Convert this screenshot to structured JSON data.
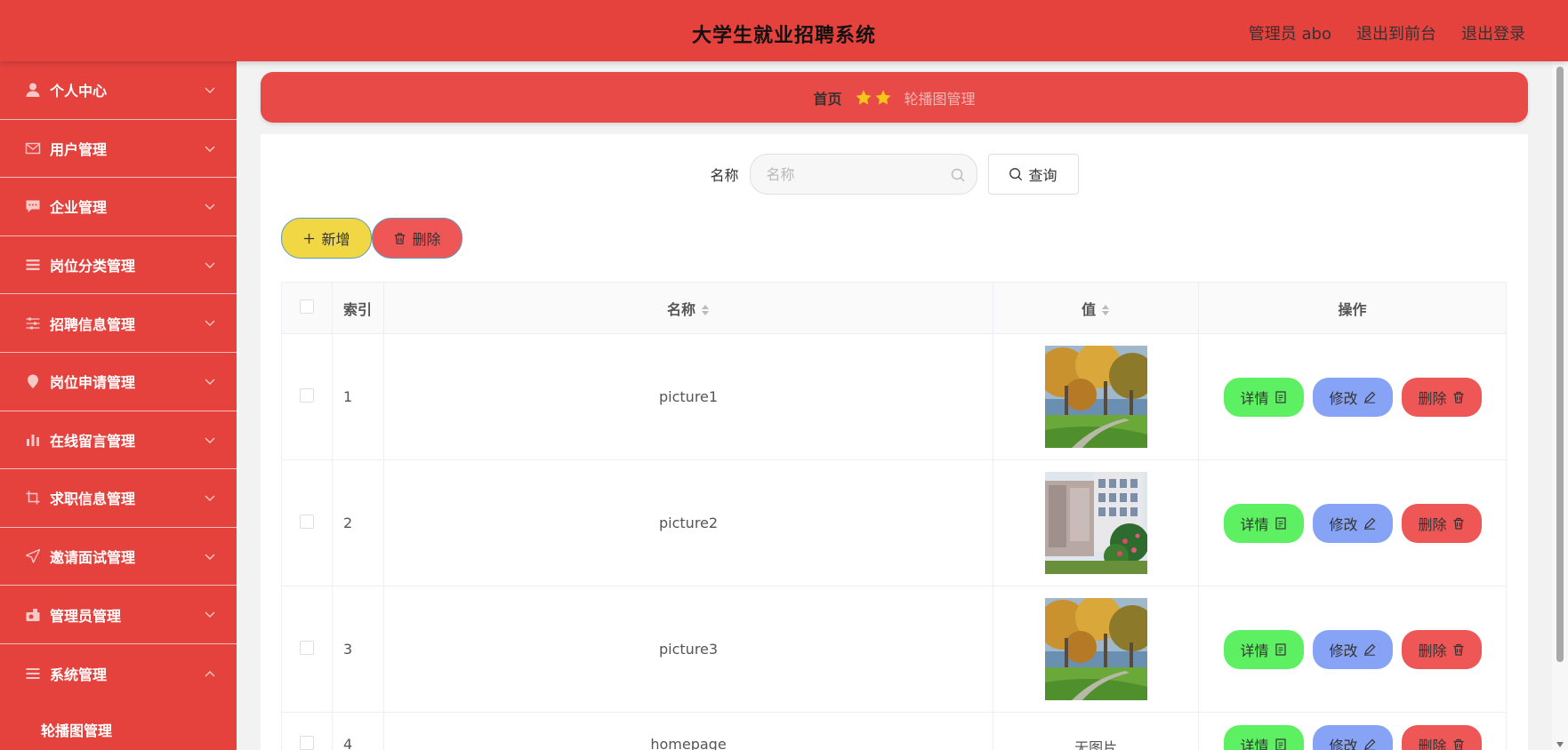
{
  "header": {
    "title": "大学生就业招聘系统",
    "links": [
      "管理员 abo",
      "退出到前台",
      "退出登录"
    ]
  },
  "sidebar": {
    "items": [
      {
        "label": "个人中心",
        "icon": "user-icon",
        "expanded": false
      },
      {
        "label": "用户管理",
        "icon": "mail-icon",
        "expanded": false
      },
      {
        "label": "企业管理",
        "icon": "chat-icon",
        "expanded": false
      },
      {
        "label": "岗位分类管理",
        "icon": "list-icon",
        "expanded": false
      },
      {
        "label": "招聘信息管理",
        "icon": "sliders-icon",
        "expanded": false
      },
      {
        "label": "岗位申请管理",
        "icon": "pin-icon",
        "expanded": false
      },
      {
        "label": "在线留言管理",
        "icon": "bar-chart-icon",
        "expanded": false
      },
      {
        "label": "求职信息管理",
        "icon": "crop-icon",
        "expanded": false
      },
      {
        "label": "邀请面试管理",
        "icon": "send-icon",
        "expanded": false
      },
      {
        "label": "管理员管理",
        "icon": "camera-icon",
        "expanded": false
      },
      {
        "label": "系统管理",
        "icon": "menu-icon",
        "expanded": true
      }
    ],
    "submenu": [
      "轮播图管理"
    ]
  },
  "breadcrumb": {
    "home": "首页",
    "current": "轮播图管理"
  },
  "search": {
    "label": "名称",
    "placeholder": "名称",
    "value": "",
    "query_label": "查询"
  },
  "actions": {
    "add_label": "新增",
    "delete_label": "删除"
  },
  "table": {
    "headers": {
      "index": "索引",
      "name": "名称",
      "value": "值",
      "ops": "操作"
    },
    "rows": [
      {
        "index": "1",
        "name": "picture1",
        "value": "image",
        "image": "autumn-campus-photo"
      },
      {
        "index": "2",
        "name": "picture2",
        "value": "image",
        "image": "campus-building-photo"
      },
      {
        "index": "3",
        "name": "picture3",
        "value": "image",
        "image": "autumn-campus-photo"
      },
      {
        "index": "4",
        "name": "homepage",
        "value": "无图片",
        "image": ""
      }
    ],
    "op_labels": {
      "detail": "详情",
      "edit": "修改",
      "delete": "删除"
    }
  },
  "colors": {
    "primary": "#e5423e",
    "add_button": "#f0d743",
    "delete_button": "#ef5656",
    "detail_button": "#5df062",
    "edit_button": "#87a3f5"
  }
}
